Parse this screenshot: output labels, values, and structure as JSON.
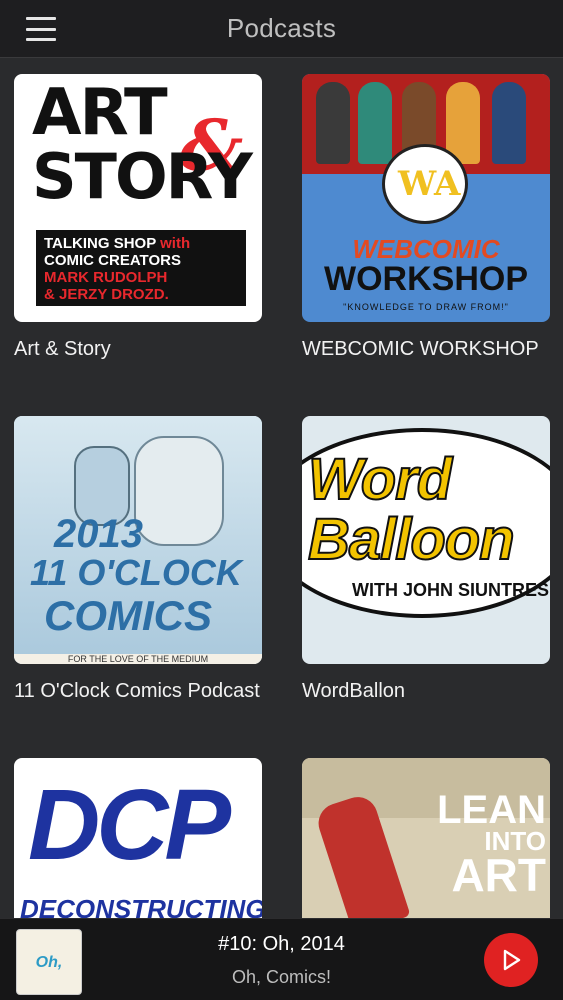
{
  "header": {
    "title": "Podcasts"
  },
  "podcasts": [
    {
      "name": "Art & Story"
    },
    {
      "name": "WEBCOMIC WORKSHOP"
    },
    {
      "name": "11 O'Clock Comics Podcast"
    },
    {
      "name": "WordBallon"
    },
    {
      "name": "DCP"
    },
    {
      "name": "Lean Into Art"
    }
  ],
  "artwork": {
    "art_story": {
      "line1": "ART",
      "amp": "&",
      "line2": "STORY",
      "sub1": "TALKING SHOP",
      "sub1_red": "with",
      "sub2": "COMIC CREATORS",
      "sub3": "MARK RUDOLPH",
      "sub4": "& JERZY DROZD."
    },
    "webcomic": {
      "logo": "WA",
      "t1": "WEBCOMIC",
      "t2": "WORKSHOP",
      "t3": "\"KNOWLEDGE TO DRAW FROM!\""
    },
    "oclock": {
      "year": "2013",
      "clock": "11 O'CLOCK",
      "comics": "COMICS",
      "footer": "FOR THE LOVE OF THE MEDIUM"
    },
    "wordballoon": {
      "w1": "Word",
      "w2": "Balloon",
      "w3": "WITH JOHN SIUNTRES"
    },
    "dcp": {
      "big": "DCP",
      "sub": "DECONSTRUCTING"
    },
    "lean": {
      "l1": "LEAN",
      "l2": "INTO",
      "l3": "ART"
    }
  },
  "player": {
    "thumb_text": "Oh, COMICS!",
    "episode_title": "#10: Oh, 2014",
    "podcast_name": "Oh, Comics!"
  },
  "colors": {
    "accent": "#e02222",
    "background": "#2a2b2d",
    "topbar": "#1e1e20",
    "player": "#161617"
  }
}
